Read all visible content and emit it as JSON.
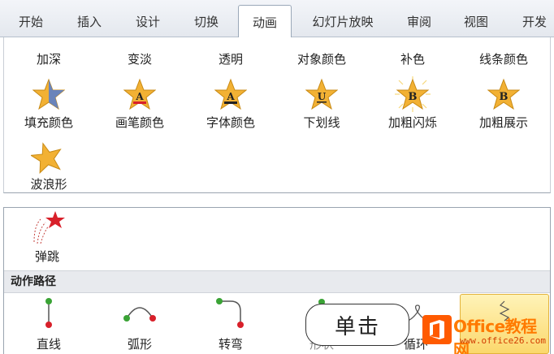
{
  "tabs": [
    {
      "label": "开始",
      "active": false
    },
    {
      "label": "插入",
      "active": false
    },
    {
      "label": "设计",
      "active": false
    },
    {
      "label": "切换",
      "active": false
    },
    {
      "label": "动画",
      "active": true
    },
    {
      "label": "幻灯片放映",
      "active": false
    },
    {
      "label": "审阅",
      "active": false
    },
    {
      "label": "视图",
      "active": false
    },
    {
      "label": "开发",
      "active": false
    }
  ],
  "emphasis_gallery": {
    "row1": [
      "加深",
      "变淡",
      "透明",
      "对象颜色",
      "补色",
      "线条颜色"
    ],
    "row2": [
      {
        "label": "填充颜色",
        "icon": "star-fill-color-icon",
        "glyph": ""
      },
      {
        "label": "画笔颜色",
        "icon": "star-brush-color-icon",
        "glyph": "A"
      },
      {
        "label": "字体颜色",
        "icon": "star-font-color-icon",
        "glyph": "A"
      },
      {
        "label": "下划线",
        "icon": "star-underline-icon",
        "glyph": "U"
      },
      {
        "label": "加粗闪烁",
        "icon": "star-bold-flash-icon",
        "glyph": "B"
      },
      {
        "label": "加粗展示",
        "icon": "star-bold-reveal-icon",
        "glyph": "B"
      }
    ],
    "row3": [
      {
        "label": "波浪形",
        "icon": "star-wave-icon"
      }
    ]
  },
  "exit_gallery": {
    "items": [
      {
        "label": "弹跳",
        "icon": "bounce-star-icon"
      }
    ]
  },
  "motion_paths": {
    "header": "动作路径",
    "items": [
      {
        "label": "直线",
        "icon": "line-path-icon"
      },
      {
        "label": "弧形",
        "icon": "arc-path-icon"
      },
      {
        "label": "转弯",
        "icon": "turn-path-icon"
      },
      {
        "label": "形状",
        "icon": "shape-path-icon"
      },
      {
        "label": "循环",
        "icon": "loop-path-icon"
      },
      {
        "label": "",
        "icon": "custom-path-icon"
      }
    ]
  },
  "callout": {
    "text": "单击"
  },
  "watermark": {
    "title": "Office教程网",
    "url": "www.office26.com"
  },
  "colors": {
    "star": "#f2b134",
    "star_edge": "#c88a14",
    "path_green": "#3aa335",
    "path_red": "#d8202a",
    "accent_orange": "#ff7a00"
  }
}
